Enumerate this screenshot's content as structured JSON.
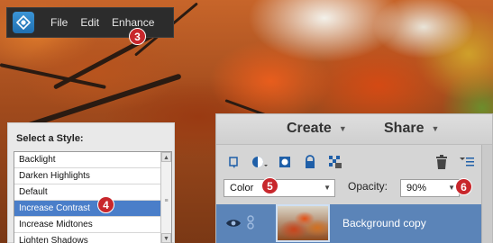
{
  "menu": {
    "items": [
      "File",
      "Edit",
      "Enhance"
    ]
  },
  "callouts": [
    "3",
    "4",
    "5",
    "6"
  ],
  "style_picker": {
    "title": "Select a Style:",
    "items": [
      "Backlight",
      "Darken Highlights",
      "Default",
      "Increase Contrast",
      "Increase Midtones",
      "Lighten Shadows"
    ],
    "selected_index": 3
  },
  "layers_panel": {
    "tabs": [
      "Create",
      "Share"
    ],
    "blend_mode": "Color",
    "opacity_label": "Opacity:",
    "opacity_value": "90%",
    "layer_name": "Background copy"
  },
  "colors": {
    "callout": "#c8272c",
    "selection": "#4a7ec9",
    "layer_selected": "#5b84b8",
    "menu_bg": "#2c2c2c"
  }
}
